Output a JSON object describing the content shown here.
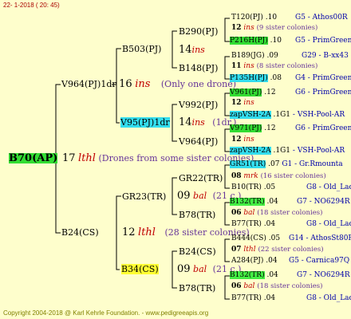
{
  "header": {
    "timestamp": "22-  1-2018 ( 20: 45)"
  },
  "footer": {
    "copyright": "Copyright 2004-2018 @ Karl Kehrle Foundation.",
    "site": "www.pedigreeapis.org"
  },
  "root": {
    "id": "B70(AP)",
    "gen": "17",
    "mark": "lthl",
    "note": "(Drones from some sister colonies)"
  },
  "g1": {
    "upper": {
      "id": "V964(PJ)1dr",
      "gen": "16",
      "mark": "ins",
      "note": "(Only one drone)"
    },
    "lower": {
      "id": "B24(CS)",
      "gen": "12",
      "mark": "lthl",
      "note": "(28 sister colonies)"
    }
  },
  "g2": {
    "a": {
      "id": "B503(PJ)",
      "gen": "14",
      "mark": "ins"
    },
    "b": {
      "id": "V95(PJ)1dr",
      "gen": "14",
      "mark": "ins",
      "note": "(1dr.)"
    },
    "c": {
      "id": "GR23(TR)",
      "gen": "09",
      "mark": "bal",
      "note": "(21 c.)"
    },
    "d": {
      "id": "B34(CS)",
      "gen": "09",
      "mark": "bal",
      "note": "(21 c.)"
    }
  },
  "g3": {
    "a": {
      "id": "B290(PJ)"
    },
    "b": {
      "id": "B148(PJ)"
    },
    "c": {
      "id": "V992(PJ)"
    },
    "d": {
      "id": "V964(PJ)"
    },
    "e": {
      "id": "GR22(TR)"
    },
    "f": {
      "id": "B78(TR)"
    },
    "g": {
      "id": "B24(CS)"
    },
    "h": {
      "id": "B78(TR)"
    }
  },
  "g4": [
    {
      "id": "T120(PJ)",
      "num": ".10",
      "info": "G5 - Athos00R"
    },
    {
      "gen": "12",
      "mark": "ins",
      "note": "(9 sister colonies)"
    },
    {
      "id": "P216H(PJ)",
      "num": ".10",
      "info": "G5 - PrimGreen00"
    },
    {
      "id": "B189(JG)",
      "num": ".09",
      "info": "G29 - B-xx43"
    },
    {
      "gen": "11",
      "mark": "ins",
      "note": "(8 sister colonies)"
    },
    {
      "id": "P135H(PJ)",
      "num": ".08",
      "info": "G4 - PrimGreen00"
    },
    {
      "id": "V961(PJ)",
      "num": ".12",
      "info": "G6 - PrimGreen00"
    },
    {
      "gen": "12",
      "mark": "ins"
    },
    {
      "id": "zapVSH-2A",
      "num": ".1G1",
      "info": "- VSH-Pool-AR"
    },
    {
      "id": "V971(PJ)",
      "num": ".12",
      "info": "G6 - PrimGreen00"
    },
    {
      "gen": "12",
      "mark": "ins"
    },
    {
      "id": "zapVSH-2A",
      "num": ".1G1",
      "info": "- VSH-Pool-AR"
    },
    {
      "id": "GR51(TR)",
      "num": ".07",
      "info": "G1 - Gr.Rmounta"
    },
    {
      "gen": "08",
      "mark": "mrk",
      "note": "(16 sister colonies)"
    },
    {
      "id": "B10(TR)",
      "num": ".05",
      "info": "G8 - Old_Lady"
    },
    {
      "id": "B132(TR)",
      "num": ".04",
      "info": "G7 - NO6294R"
    },
    {
      "gen": "06",
      "mark": "bal",
      "note": "(18 sister colonies)"
    },
    {
      "id": "B77(TR)",
      "num": ".04",
      "info": "G8 - Old_Lady"
    },
    {
      "id": "B444(CS)",
      "num": ".05",
      "info": "G14 - AthosSt80R"
    },
    {
      "gen": "07",
      "mark": "lthl",
      "note": "(22 sister colonies)"
    },
    {
      "id": "A284(PJ)",
      "num": ".04",
      "info": "G5 - Carnica97Q"
    },
    {
      "id": "B132(TR)",
      "num": ".04",
      "info": "G7 - NO6294R"
    },
    {
      "gen": "06",
      "mark": "bal",
      "note": "(18 sister colonies)"
    },
    {
      "id": "B77(TR)",
      "num": ".04",
      "info": "G8 - Old_Lady"
    }
  ],
  "colors": {
    "background": "#fefecc",
    "lines": "#000000",
    "gen_mark": "#c00000",
    "note": "#663399",
    "info": "#0000aa"
  }
}
